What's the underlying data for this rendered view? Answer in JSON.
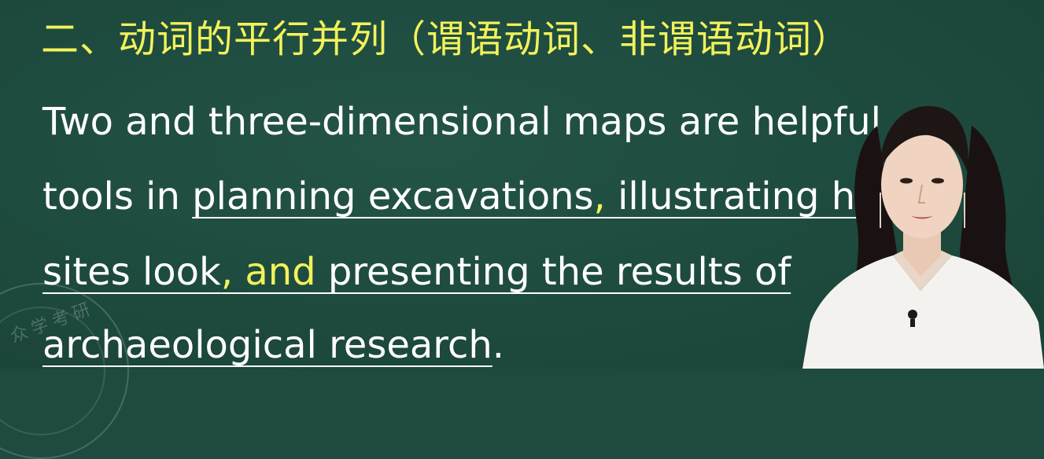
{
  "heading": "二、动词的平行并列（谓语动词、非谓语动词）",
  "lines": {
    "l1": "Two and three-dimensional maps are helpful",
    "l2_a": "tools in ",
    "l2_b": "planning excavations",
    "l2_c": ",",
    "l2_d": " illustrating how",
    "l3_a": "sites look",
    "l3_b": ", and ",
    "l3_c": "presenting the results of",
    "l4_a": "archaeological research",
    "l4_b": "."
  },
  "watermark": "众学考研",
  "colors": {
    "board": "#1f4a3f",
    "highlight": "#f2f25a",
    "text": "#ffffff"
  }
}
